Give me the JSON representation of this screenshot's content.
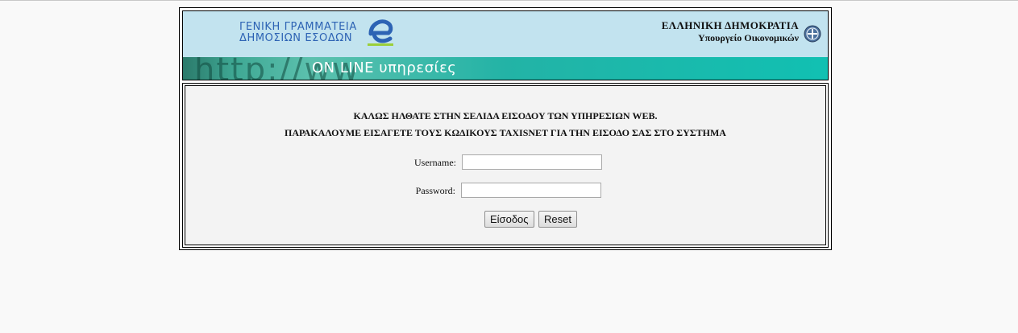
{
  "header": {
    "gsis_line1": "ΓΕΝΙΚΗ ΓΡΑΜΜΑΤΕΙΑ",
    "gsis_line2": "ΔΗΜΟΣΙΩΝ ΕΣΟΔΩΝ",
    "gsis_icon": "e-logo-icon",
    "gov_line1": "ΕΛΛΗΝΙΚΗ ΔΗΜΟΚΡΑΤΙΑ",
    "gov_line2": "Υπουργείο Οικονομικών",
    "emblem_icon": "greek-emblem-icon",
    "banner_http": "http://ww",
    "banner_services": "ON LINE υπηρεσίες"
  },
  "login": {
    "welcome_line1": "ΚΑΛΩΣ ΗΛΘΑΤΕ ΣΤΗΝ ΣΕΛΙΔΑ ΕΙΣΟΔΟΥ ΤΩΝ ΥΠΗΡΕΣΙΩΝ WEB.",
    "welcome_line2": "ΠΑΡΑΚΑΛΟΥΜΕ ΕΙΣΑΓΕΤΕ ΤΟΥΣ ΚΩΔΙΚΟΥΣ TAXISNET ΓΙΑ ΤΗΝ ΕΙΣΟΔΟ ΣΑΣ ΣΤΟ ΣΥΣΤΗΜΑ",
    "username_label": "Username:",
    "username_value": "",
    "password_label": "Password:",
    "password_value": "",
    "submit_label": "Είσοδος",
    "reset_label": "Reset"
  },
  "colors": {
    "header_bg": "#c2e3ef",
    "banner_accent": "#11c0b2",
    "logo_blue": "#2d63b4",
    "form_bg": "#f3f3f3"
  }
}
